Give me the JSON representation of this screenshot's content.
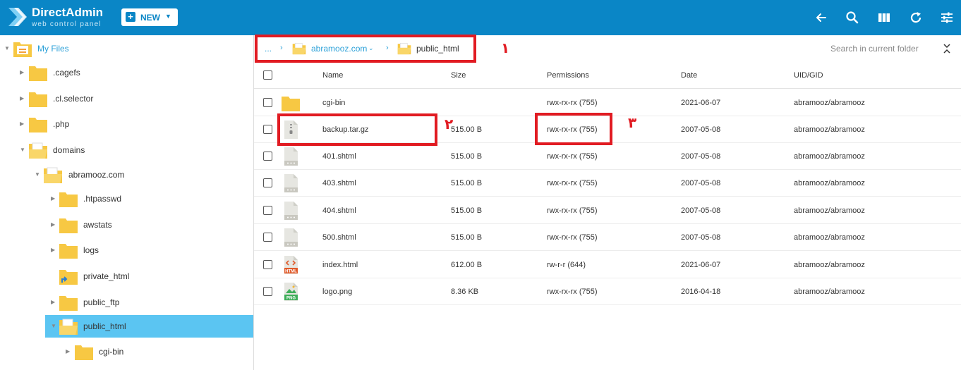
{
  "header": {
    "logo_title": "DirectAdmin",
    "logo_subtitle": "web control panel",
    "new_button_label": "NEW",
    "toolbar_icons": [
      "back-arrow-icon",
      "search-icon",
      "columns-icon",
      "refresh-icon",
      "settings-sliders-icon"
    ]
  },
  "colors": {
    "header_bg": "#0a86c6",
    "selected_bg": "#5bc5f2",
    "folder_yellow": "#f7c843",
    "highlight_red": "#e11b22",
    "link_blue": "#2aa0d8"
  },
  "tree": {
    "items": [
      {
        "label": "My Files"
      },
      {
        "label": ".cagefs"
      },
      {
        "label": ".cl.selector"
      },
      {
        "label": ".php"
      },
      {
        "label": "domains"
      },
      {
        "label": "abramooz.com"
      },
      {
        "label": ".htpasswd"
      },
      {
        "label": "awstats"
      },
      {
        "label": "logs"
      },
      {
        "label": "private_html"
      },
      {
        "label": "public_ftp"
      },
      {
        "label": "public_html"
      },
      {
        "label": "cgi-bin"
      }
    ]
  },
  "breadcrumb": {
    "ellipsis": "...",
    "domain": "abramooz.com",
    "current": "public_html"
  },
  "search": {
    "placeholder": "Search in current folder"
  },
  "table": {
    "columns": [
      "Name",
      "Size",
      "Permissions",
      "Date",
      "UID/GID"
    ],
    "rows": [
      {
        "icon": "folder-icon",
        "name": "cgi-bin",
        "size": "",
        "perm": "rwx-rx-rx (755)",
        "date": "2021-06-07",
        "uid": "abramooz/abramooz"
      },
      {
        "icon": "archive-file-icon",
        "name": "backup.tar.gz",
        "size": "515.00 B",
        "perm": "rwx-rx-rx (755)",
        "date": "2007-05-08",
        "uid": "abramooz/abramooz"
      },
      {
        "icon": "generic-file-icon",
        "name": "401.shtml",
        "size": "515.00 B",
        "perm": "rwx-rx-rx (755)",
        "date": "2007-05-08",
        "uid": "abramooz/abramooz"
      },
      {
        "icon": "generic-file-icon",
        "name": "403.shtml",
        "size": "515.00 B",
        "perm": "rwx-rx-rx (755)",
        "date": "2007-05-08",
        "uid": "abramooz/abramooz"
      },
      {
        "icon": "generic-file-icon",
        "name": "404.shtml",
        "size": "515.00 B",
        "perm": "rwx-rx-rx (755)",
        "date": "2007-05-08",
        "uid": "abramooz/abramooz"
      },
      {
        "icon": "generic-file-icon",
        "name": "500.shtml",
        "size": "515.00 B",
        "perm": "rwx-rx-rx (755)",
        "date": "2007-05-08",
        "uid": "abramooz/abramooz"
      },
      {
        "icon": "html-file-icon",
        "name": "index.html",
        "size": "612.00 B",
        "perm": "rw-r-r (644)",
        "date": "2021-06-07",
        "uid": "abramooz/abramooz"
      },
      {
        "icon": "png-file-icon",
        "name": "logo.png",
        "size": "8.36 KB",
        "perm": "rwx-rx-rx (755)",
        "date": "2016-04-18",
        "uid": "abramooz/abramooz"
      }
    ]
  },
  "annotations": {
    "n1": "١",
    "n2": "٢",
    "n3": "٣"
  },
  "file_badges": {
    "html": "HTML",
    "png": "PNG"
  }
}
